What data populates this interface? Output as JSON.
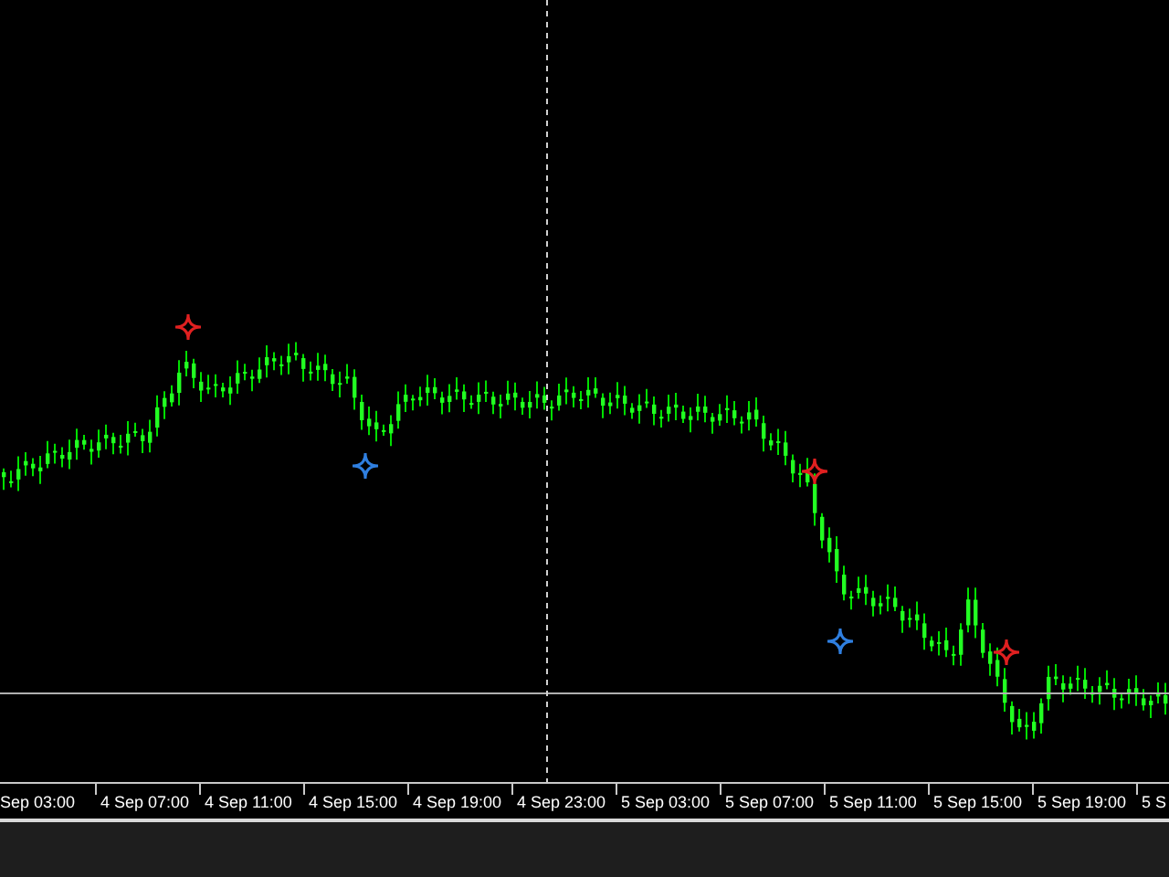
{
  "signals": [
    {
      "color": "#e02020"
    },
    {
      "color": "#2f7fe0"
    },
    {
      "color": "#e02020"
    },
    {
      "color": "#2f7fe0"
    },
    {
      "color": "#e02020"
    }
  ],
  "time_axis": {
    "labels": [
      "Sep 03:00",
      "4 Sep 07:00",
      "4 Sep 11:00",
      "4 Sep 15:00",
      "4 Sep 19:00",
      "4 Sep 23:00",
      "5 Sep 03:00",
      "5 Sep 07:00",
      "5 Sep 11:00",
      "5 Sep 15:00",
      "5 Sep 19:00",
      "5 S"
    ]
  }
}
